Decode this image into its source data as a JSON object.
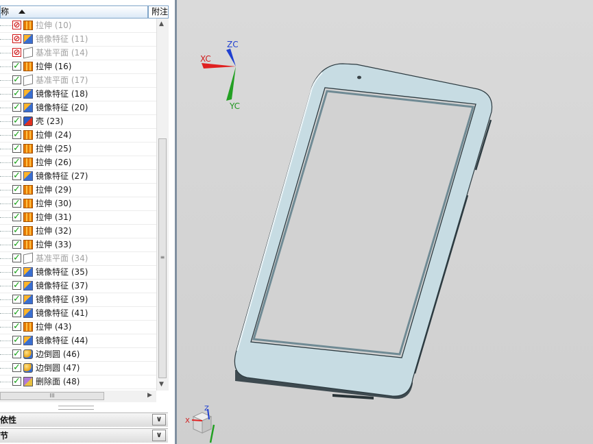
{
  "tree_header": {
    "name_col": "称",
    "note_col": "附注"
  },
  "features": [
    {
      "label": "拉伸 (10)",
      "type": "extrude",
      "suppressed": true
    },
    {
      "label": "镜像特征 (11)",
      "type": "mirror",
      "suppressed": true
    },
    {
      "label": "基准平面 (14)",
      "type": "datum",
      "suppressed": true
    },
    {
      "label": "拉伸 (16)",
      "type": "extrude",
      "suppressed": false
    },
    {
      "label": "基准平面 (17)",
      "type": "datum",
      "suppressed": false,
      "dim": true
    },
    {
      "label": "镜像特征 (18)",
      "type": "mirror",
      "suppressed": false
    },
    {
      "label": "镜像特征 (20)",
      "type": "mirror",
      "suppressed": false
    },
    {
      "label": "壳 (23)",
      "type": "shell",
      "suppressed": false
    },
    {
      "label": "拉伸 (24)",
      "type": "extrude",
      "suppressed": false
    },
    {
      "label": "拉伸 (25)",
      "type": "extrude",
      "suppressed": false
    },
    {
      "label": "拉伸 (26)",
      "type": "extrude",
      "suppressed": false
    },
    {
      "label": "镜像特征 (27)",
      "type": "mirror",
      "suppressed": false
    },
    {
      "label": "拉伸 (29)",
      "type": "extrude",
      "suppressed": false
    },
    {
      "label": "拉伸 (30)",
      "type": "extrude",
      "suppressed": false
    },
    {
      "label": "拉伸 (31)",
      "type": "extrude",
      "suppressed": false
    },
    {
      "label": "拉伸 (32)",
      "type": "extrude",
      "suppressed": false
    },
    {
      "label": "拉伸 (33)",
      "type": "extrude",
      "suppressed": false
    },
    {
      "label": "基准平面 (34)",
      "type": "datum",
      "suppressed": false,
      "dim": true
    },
    {
      "label": "镜像特征 (35)",
      "type": "mirror",
      "suppressed": false
    },
    {
      "label": "镜像特征 (37)",
      "type": "mirror",
      "suppressed": false
    },
    {
      "label": "镜像特征 (39)",
      "type": "mirror",
      "suppressed": false
    },
    {
      "label": "镜像特征 (41)",
      "type": "mirror",
      "suppressed": false
    },
    {
      "label": "拉伸 (43)",
      "type": "extrude",
      "suppressed": false
    },
    {
      "label": "镜像特征 (44)",
      "type": "mirror",
      "suppressed": false
    },
    {
      "label": "边倒圆 (46)",
      "type": "blend",
      "suppressed": false
    },
    {
      "label": "边倒圆 (47)",
      "type": "blend",
      "suppressed": false
    },
    {
      "label": "删除面 (48)",
      "type": "delete",
      "suppressed": false
    }
  ],
  "panels": {
    "dependencies": "依性",
    "details": "节"
  },
  "axes_main": {
    "xc": "XC",
    "yc": "YC",
    "zc": "ZC"
  },
  "axes_mini": {
    "x": "X",
    "z": "Z"
  },
  "colors": {
    "model_face": "#c9dde4",
    "model_edge": "#2c3a40",
    "axis_x": "#e02020",
    "axis_y": "#23a023",
    "axis_z": "#2040d0"
  }
}
